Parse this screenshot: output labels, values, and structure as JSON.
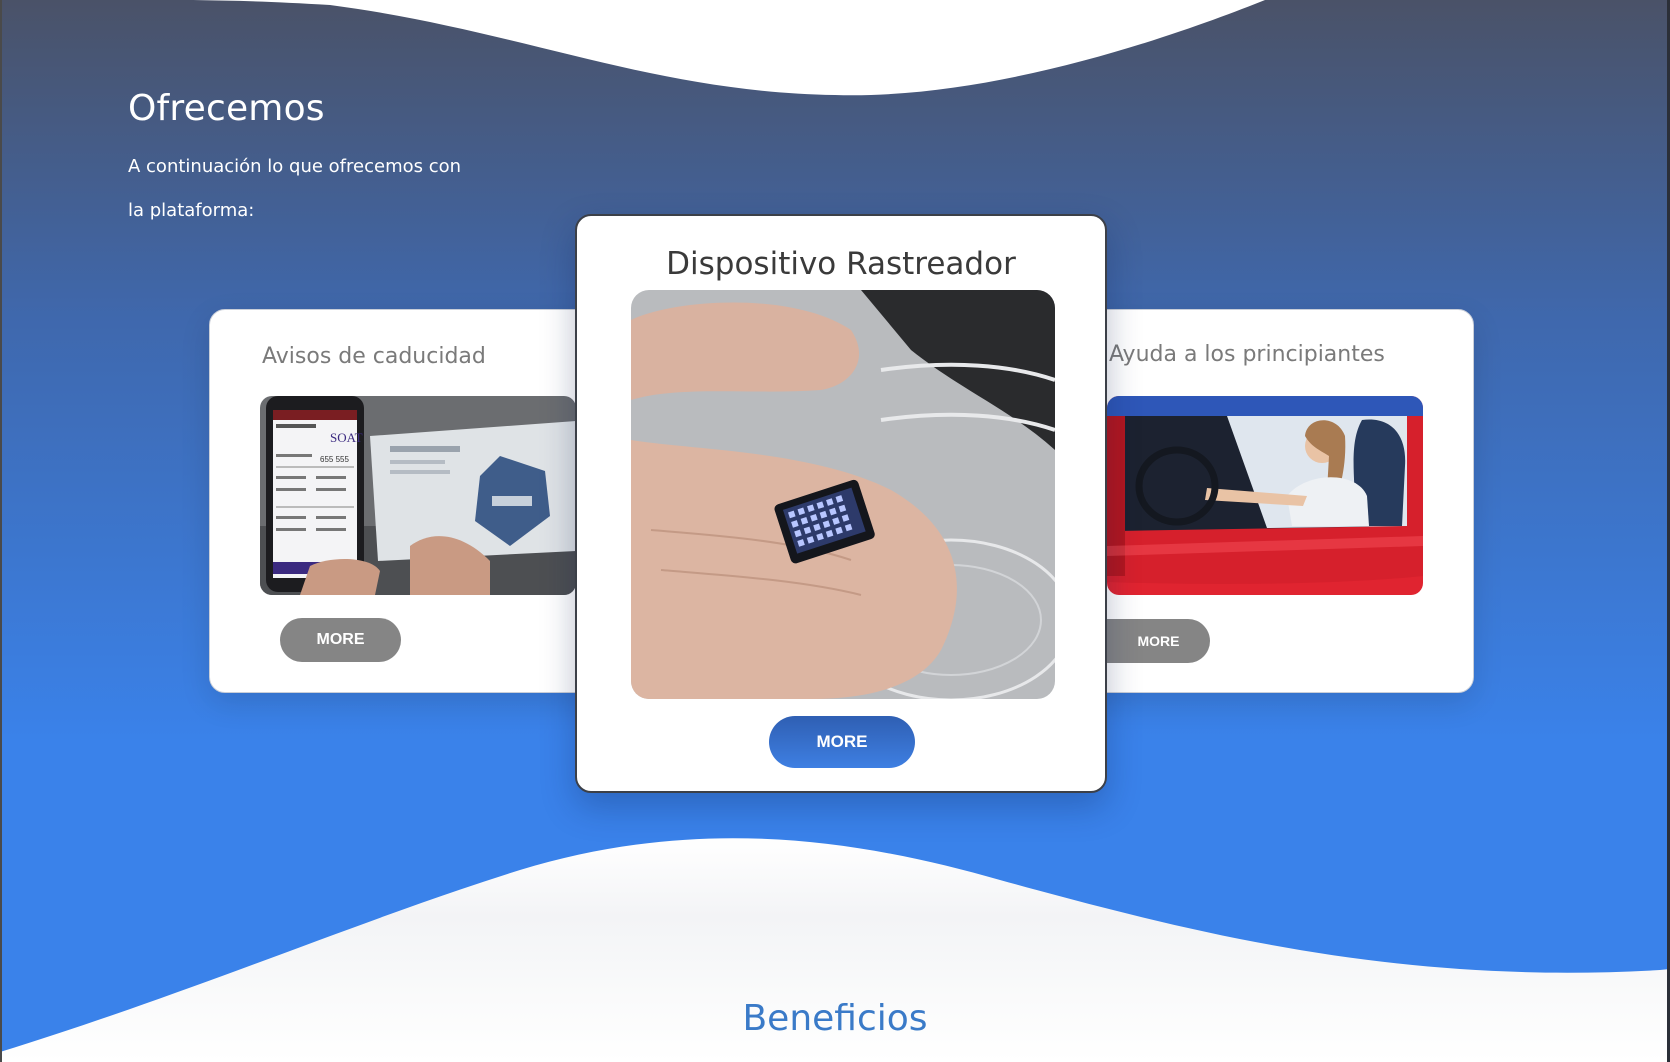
{
  "colors": {
    "hero_gradient_top": "#4a5268",
    "hero_gradient_mid": "#3f68ad",
    "hero_gradient_bottom": "#3a82ea",
    "button_grey": "#858585",
    "button_blue_top": "#2f5fb3",
    "button_blue_bottom": "#3e7fe2",
    "heading_blue": "#3a7ac8"
  },
  "section": {
    "title": "Ofrecemos",
    "description": "A continuación lo que ofrecemos con la plataforma:"
  },
  "cards": [
    {
      "title": "Avisos de caducidad",
      "button_label": "MORE",
      "image": "soat-phone-document-photo"
    },
    {
      "title": "Dispositivo Rastreador",
      "button_label": "MORE",
      "image": "tracking-chip-on-finger-photo"
    },
    {
      "title": "Ayuda a los principiantes",
      "button_label": "MORE",
      "image": "woman-driving-red-car-photo"
    }
  ],
  "next_section": {
    "title": "Beneficios"
  }
}
